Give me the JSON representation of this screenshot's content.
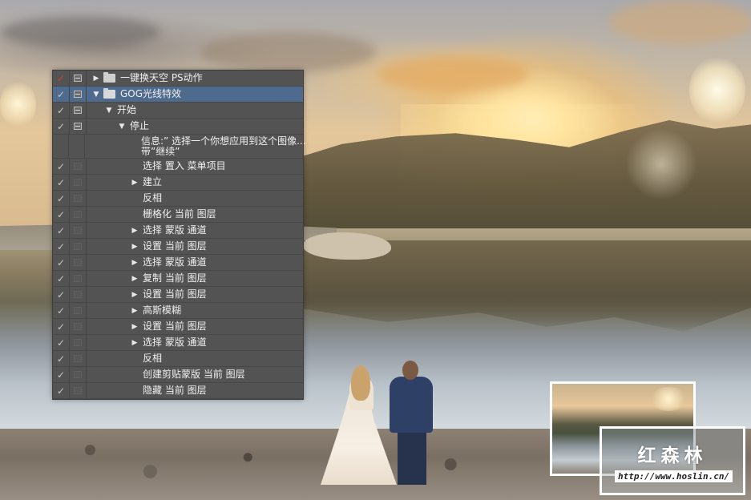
{
  "actions_panel": {
    "rows": [
      {
        "check": "red",
        "dialog": "on",
        "toggle": "collapsed",
        "icon": "folder-icon",
        "label": "一键换天空 PS动作",
        "selected": false
      },
      {
        "check": "on",
        "dialog": "on",
        "toggle": "expanded",
        "icon": "folder-open-icon",
        "label": "GOG光线特效",
        "selected": true
      },
      {
        "check": "on",
        "dialog": "on",
        "toggle": "expanded",
        "label": "开始"
      },
      {
        "check": "on",
        "dialog": "on",
        "toggle": "expanded",
        "label": "停止"
      },
      {
        "check": "none",
        "dialog": "none",
        "toggle": "none",
        "label": "信息:” 选择一个你想应用到这个图像...",
        "label_line2": "带”继续”"
      },
      {
        "check": "on",
        "dialog": "off",
        "toggle": "none",
        "label": "选择 置入 菜单项目"
      },
      {
        "check": "on",
        "dialog": "off",
        "toggle": "collapsed",
        "label": "建立"
      },
      {
        "check": "on",
        "dialog": "off",
        "toggle": "none",
        "label": "反相"
      },
      {
        "check": "on",
        "dialog": "off",
        "toggle": "none",
        "label": "栅格化 当前 图层"
      },
      {
        "check": "on",
        "dialog": "off",
        "toggle": "collapsed",
        "label": "选择 蒙版 通道"
      },
      {
        "check": "on",
        "dialog": "off",
        "toggle": "collapsed",
        "label": "设置 当前 图层"
      },
      {
        "check": "on",
        "dialog": "off",
        "toggle": "collapsed",
        "label": "选择 蒙版 通道"
      },
      {
        "check": "on",
        "dialog": "off",
        "toggle": "collapsed",
        "label": "复制 当前 图层"
      },
      {
        "check": "on",
        "dialog": "off",
        "toggle": "collapsed",
        "label": "设置 当前 图层"
      },
      {
        "check": "on",
        "dialog": "off",
        "toggle": "collapsed",
        "label": "高斯模糊"
      },
      {
        "check": "on",
        "dialog": "off",
        "toggle": "collapsed",
        "label": "设置 当前 图层"
      },
      {
        "check": "on",
        "dialog": "off",
        "toggle": "collapsed",
        "label": "选择 蒙版 通道"
      },
      {
        "check": "on",
        "dialog": "off",
        "toggle": "none",
        "label": "反相"
      },
      {
        "check": "on",
        "dialog": "off",
        "toggle": "none",
        "label": "创建剪贴蒙版 当前 图层"
      },
      {
        "check": "on",
        "dialog": "off",
        "toggle": "none",
        "label": "隐藏 当前 图层"
      }
    ]
  },
  "watermark": {
    "title": "红森林",
    "url": "http://www.hoslin.cn/"
  },
  "colors": {
    "panel_bg": "#535353",
    "selected_row": "#4e6a8d",
    "check_red": "#d23b2e"
  }
}
